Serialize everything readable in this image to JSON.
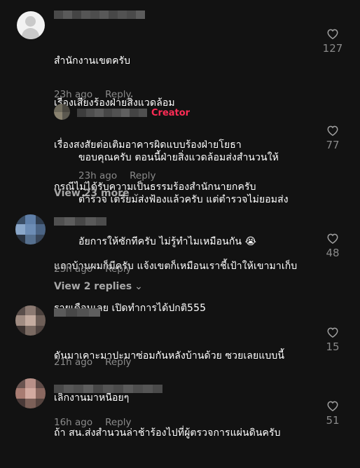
{
  "comments": [
    {
      "lines": [
        "สำนักงานเขตครับ",
        "เรื่องเสียงร้องฝ่ายสิ่งแวดล้อม",
        "เรื่องสงสัยต่อเติมอาคารผิดแบบร้องฝ่ายโยธา",
        "กรณีไม่ได้รับความเป็นธรรมร้องสำนักนายกครับ"
      ],
      "time": "23h ago",
      "reply": "Reply",
      "likes": "127"
    },
    {
      "badge": "Creator",
      "lines": [
        "ขอบคุณครับ ตอนนี้ฝ่ายสิ่งแวดล้อมส่งสำนวนให้",
        "ตำรวจ เตรียมส่งฟ้องแล้วครับ แต่ตำรวจไม่ยอมส่ง",
        "อัยการให้ซักทีครับ ไม่รู้ทำไมเหมือนกัน 😭"
      ],
      "time": "23h ago",
      "reply": "Reply",
      "likes": "77"
    },
    {
      "lines": [
        "แถวบ้านผมก็มีครับ แจ้งเขตก็เหมือนเราชี้เป้าให้เขามาเก็บ",
        "รายเดือนเลย เปิดทำการได้ปกติ555"
      ],
      "time": "23h ago",
      "reply": "Reply",
      "likes": "48"
    },
    {
      "lines": [
        "ดันมาเคาะมาปะมาซ่อมกันหลังบ้านด้วย ซวยเลยแบบนี้",
        "เลิกงานมาหนื่อยๆ"
      ],
      "time": "21h ago",
      "reply": "Reply",
      "likes": "15"
    },
    {
      "lines": [
        "ถ้า สน.ส่งสำนวนล่าช้าร้องไปที่ผู้ตรวจการแผ่นดินครับ"
      ],
      "time": "16h ago",
      "reply": "Reply",
      "likes": "51"
    }
  ],
  "view_more": [
    "View 23 more",
    "View 2 replies"
  ],
  "icons": {
    "like": "heart-outline-icon",
    "chevron": "chevron-down-icon"
  },
  "colors": {
    "background": "#121212",
    "creator": "#fe2c55",
    "muted": "#8a8a8a"
  }
}
